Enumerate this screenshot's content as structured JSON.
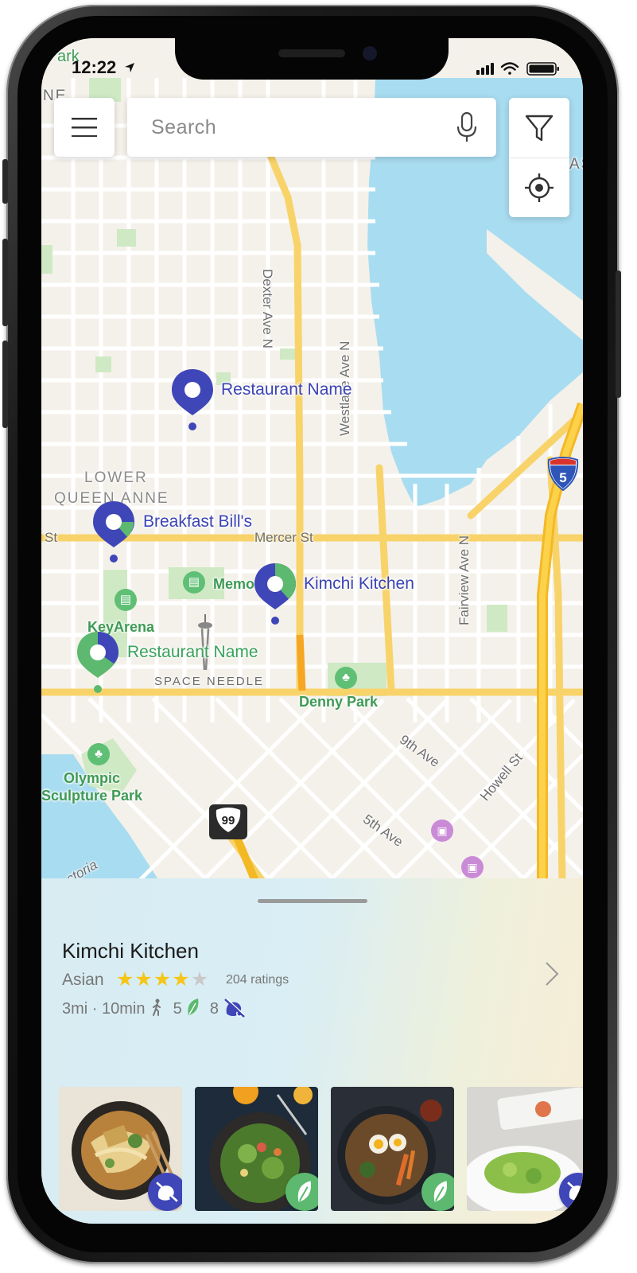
{
  "status_bar": {
    "time": "12:22"
  },
  "search": {
    "placeholder": "Search"
  },
  "map": {
    "area_labels": [
      "LOWER",
      "QUEEN ANNE",
      "SPACE NEEDLE"
    ],
    "street_labels": [
      "Dexter Ave N",
      "Westlake Ave N",
      "Mercer St",
      "Fairview Ave N",
      "9th Ave",
      "Howell St",
      "5th Ave",
      "St",
      "ctoria"
    ],
    "park_labels": [
      "Memorial",
      "KeyArena",
      "Denny Park",
      "Olympic",
      "Sculpture Park"
    ],
    "highway_shields": [
      "5",
      "99"
    ],
    "top_corner_labels": [
      "ark",
      "NE",
      "AS"
    ]
  },
  "pins": [
    {
      "label": "Restaurant Name",
      "style": "blue"
    },
    {
      "label": "Breakfast Bill's",
      "style": "blue"
    },
    {
      "label": "Kimchi Kitchen",
      "style": "blue"
    },
    {
      "label": "Restaurant Name",
      "style": "green"
    }
  ],
  "selected_restaurant": {
    "name": "Kimchi Kitchen",
    "cuisine": "Asian",
    "rating": 4,
    "rating_max": 5,
    "ratings_count": "204 ratings",
    "distance": "3mi · 10min",
    "leaf_count": "5",
    "no_meat_count": "8"
  },
  "photos": [
    {
      "name": "ramen-bowl",
      "badge": "no-meat-icon"
    },
    {
      "name": "green-salad-bowl",
      "badge": "leaf-icon"
    },
    {
      "name": "bibimbap-bowl",
      "badge": "leaf-icon"
    },
    {
      "name": "salad-plate",
      "badge": "no-meat-icon"
    }
  ],
  "colors": {
    "brand_blue": "#3a43b3",
    "brand_green": "#5cb96f",
    "water": "#a8dcf0",
    "road_major": "#fbd75b",
    "star": "#f5c518"
  }
}
